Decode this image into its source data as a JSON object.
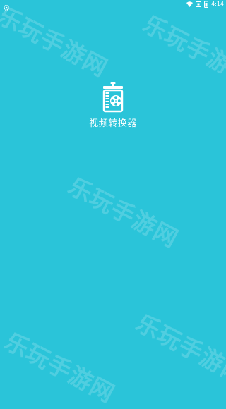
{
  "status_bar": {
    "time": "4:14",
    "icons": [
      "settings-gear-icon",
      "wifi-icon",
      "screenshot-icon",
      "battery-icon"
    ]
  },
  "splash": {
    "app_name": "视频转换器",
    "logo_icon": "video-converter-logo-icon"
  },
  "watermark": {
    "text": "乐玩手游网"
  },
  "colors": {
    "background": "#2ac4d9",
    "foreground": "#ffffff"
  }
}
